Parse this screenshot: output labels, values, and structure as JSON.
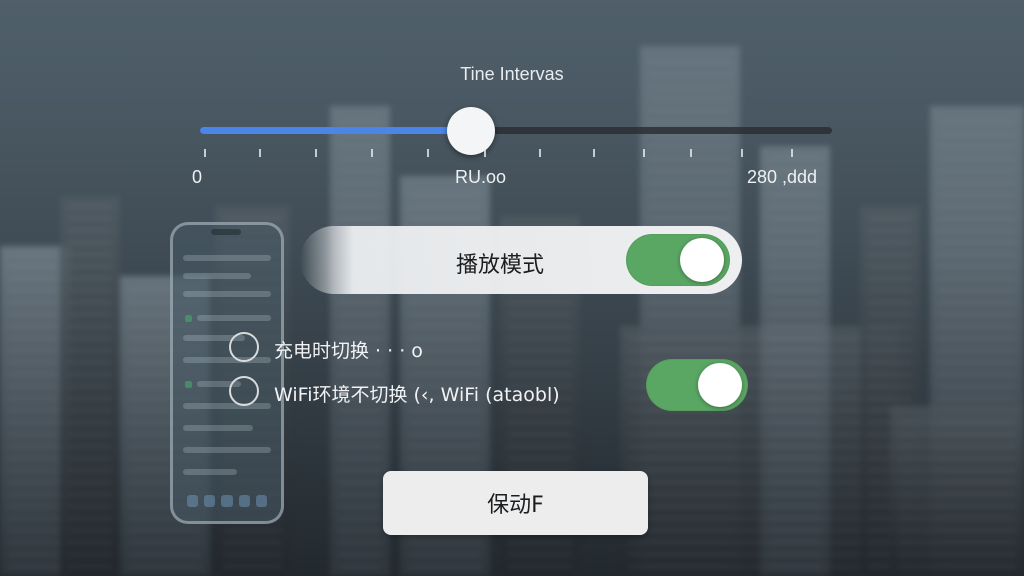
{
  "slider": {
    "title": "Tine Intervas",
    "value_fraction": 0.429,
    "tick_labels": [
      "0",
      "RU.oo",
      "280 ,ddd"
    ]
  },
  "play_mode": {
    "label": "播放模式",
    "toggle_on": true
  },
  "options": [
    {
      "label": "充电时切换 · · ·  o",
      "selected": false
    },
    {
      "label": "WiFi环境不切换 (‹, WiFi (ataobl)",
      "selected": false
    }
  ],
  "wifi_toggle_on": true,
  "action_button": {
    "label": "保动F"
  },
  "colors": {
    "slider_fill": "#4a86e8",
    "toggle_on": "#5aa663",
    "panel": "#eeeff0"
  }
}
